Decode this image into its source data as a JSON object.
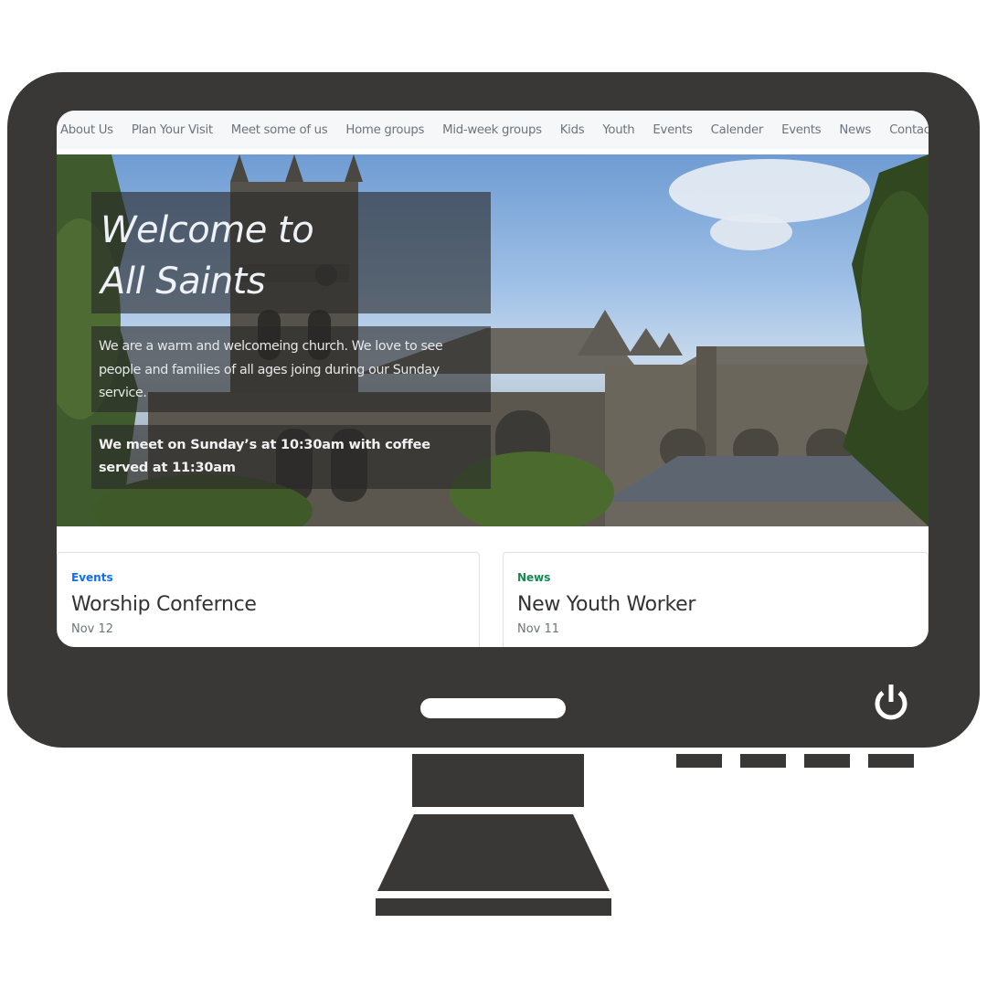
{
  "nav": {
    "items": [
      "About Us",
      "Plan Your Visit",
      "Meet some of us",
      "Home groups",
      "Mid-week groups",
      "Kids",
      "Youth",
      "Events",
      "Calender",
      "Events",
      "News",
      "Contact Us"
    ]
  },
  "hero": {
    "title_line1": "Welcome to",
    "title_line2": "All Saints",
    "intro": "We are a warm and welcomeing church. We love to see people and families of all ages joing during our Sunday service.",
    "meeting": "We meet on Sunday’s at 10:30am with coffee served at 11:30am"
  },
  "cards": [
    {
      "tag": "Events",
      "title": "Worship Confernce",
      "date": "Nov 12",
      "tag_color": "#0d6efd"
    },
    {
      "tag": "News",
      "title": "New Youth Worker",
      "date": "Nov 11",
      "tag_color": "#198754"
    }
  ],
  "icons": {
    "power": "power-icon"
  },
  "colors": {
    "monitor": "#3a3836",
    "nav_text": "#6c757d"
  }
}
